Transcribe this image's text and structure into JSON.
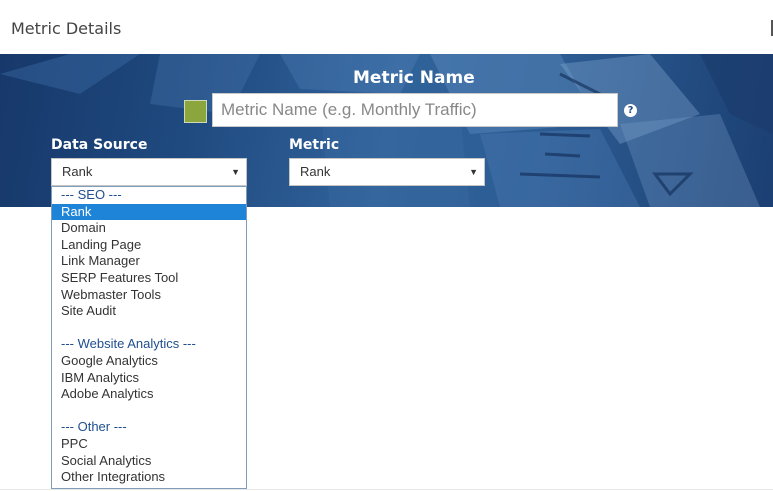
{
  "page": {
    "title": "Metric Details"
  },
  "banner": {
    "metric_name_title": "Metric Name",
    "metric_name_placeholder": "Metric Name (e.g. Monthly Traffic)",
    "swatch_color": "#8aa63d",
    "help_icon": "question-circle-icon"
  },
  "data_source": {
    "label": "Data Source",
    "selected": "Rank",
    "options": [
      {
        "label": "--- SEO ---",
        "kind": "group"
      },
      {
        "label": "Rank",
        "kind": "option",
        "selected": true
      },
      {
        "label": "Domain",
        "kind": "option"
      },
      {
        "label": "Landing Page",
        "kind": "option"
      },
      {
        "label": "Link Manager",
        "kind": "option"
      },
      {
        "label": "SERP Features Tool",
        "kind": "option"
      },
      {
        "label": "Webmaster Tools",
        "kind": "option"
      },
      {
        "label": "Site Audit",
        "kind": "option"
      },
      {
        "label": "",
        "kind": "spacer"
      },
      {
        "label": "--- Website Analytics ---",
        "kind": "group"
      },
      {
        "label": "Google Analytics",
        "kind": "option"
      },
      {
        "label": "IBM Analytics",
        "kind": "option"
      },
      {
        "label": "Adobe Analytics",
        "kind": "option"
      },
      {
        "label": "",
        "kind": "spacer"
      },
      {
        "label": "--- Other ---",
        "kind": "group"
      },
      {
        "label": "PPC",
        "kind": "option"
      },
      {
        "label": "Social Analytics",
        "kind": "option"
      },
      {
        "label": "Other Integrations",
        "kind": "option"
      }
    ]
  },
  "metric": {
    "label": "Metric",
    "selected": "Rank"
  },
  "colors": {
    "selected_bg": "#1e84d8",
    "group_text": "#1f4f8f",
    "banner_base": "#1f4a80"
  }
}
